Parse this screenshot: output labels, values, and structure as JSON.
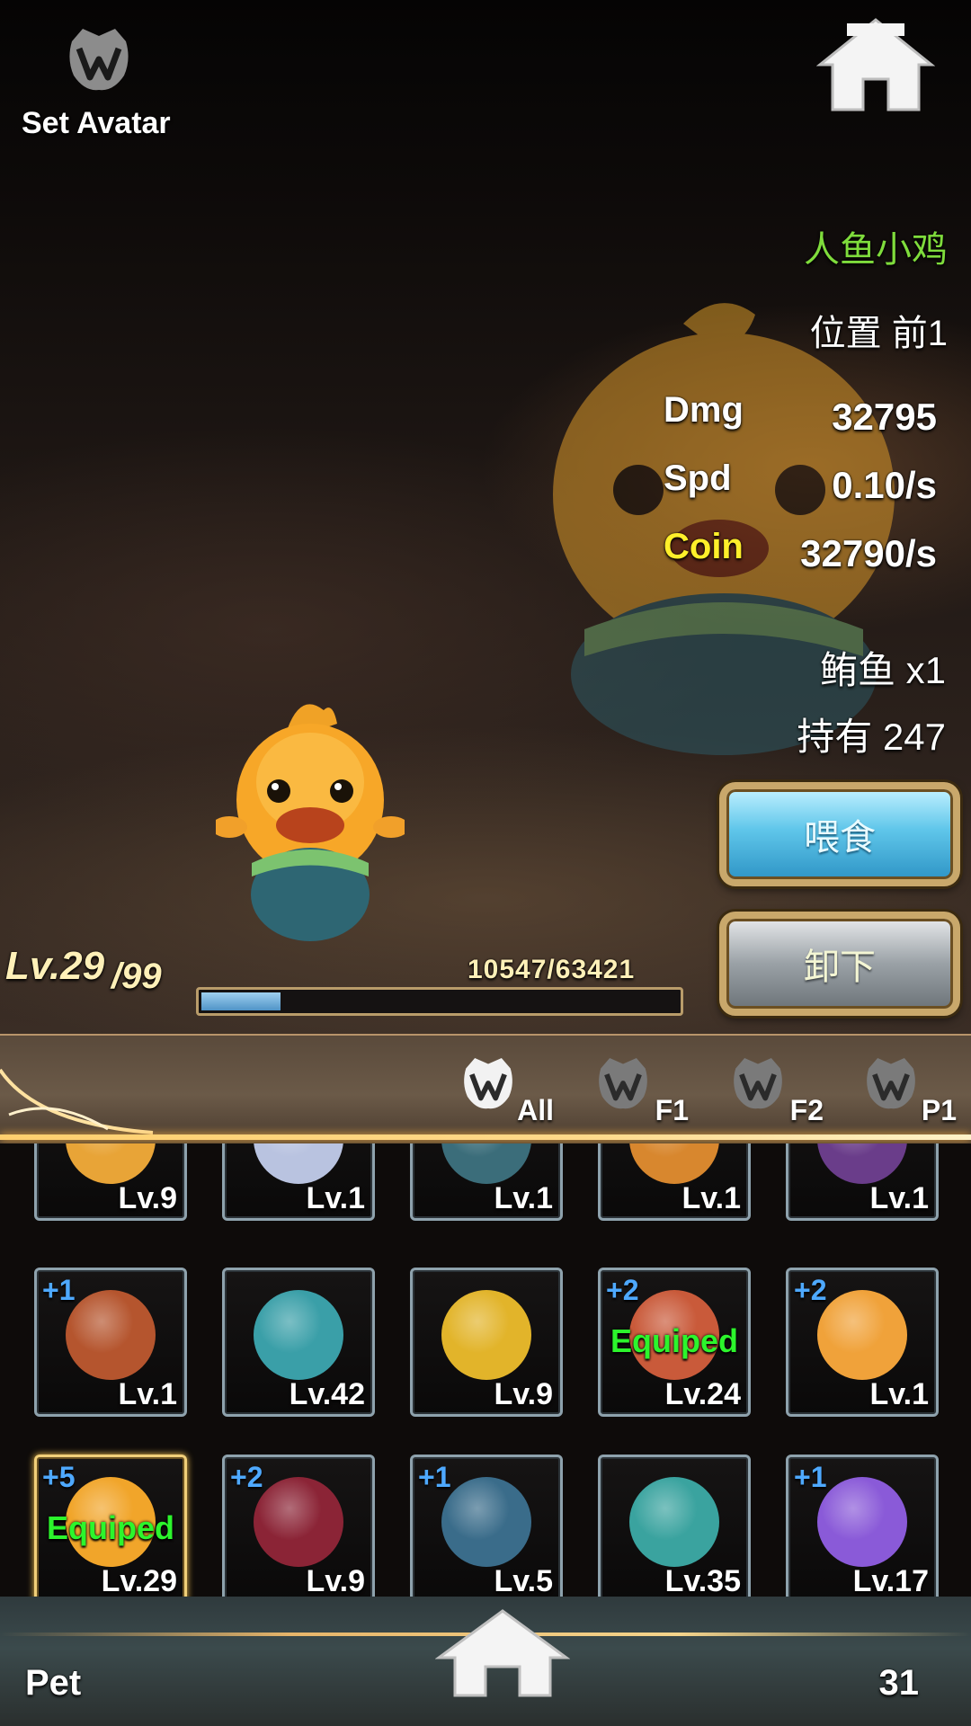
{
  "header": {
    "set_avatar_label": "Set Avatar"
  },
  "pet": {
    "name": "人鱼小鸡",
    "position": "位置 前1",
    "stats": [
      {
        "label": "Dmg",
        "value": "32795"
      },
      {
        "label": "Spd",
        "value": "0.10/s"
      },
      {
        "label": "Coin",
        "value": "32790/s"
      }
    ],
    "food": "鲔鱼 x1",
    "hold": "持有 247",
    "level": "Lv.29",
    "level_max": "/99",
    "exp_text": "10547/63421",
    "exp_fraction": 0.166
  },
  "buttons": {
    "feed": "喂食",
    "unload": "卸下"
  },
  "filters": [
    {
      "label": "All"
    },
    {
      "label": "F1"
    },
    {
      "label": "F2"
    },
    {
      "label": "P1"
    }
  ],
  "grid": [
    {
      "level": "Lv.9",
      "plus": "",
      "equipped": "",
      "color": "#e8a437"
    },
    {
      "level": "Lv.1",
      "plus": "",
      "equipped": "",
      "color": "#b9c3e0"
    },
    {
      "level": "Lv.1",
      "plus": "",
      "equipped": "",
      "color": "#3b6d7a"
    },
    {
      "level": "Lv.1",
      "plus": "",
      "equipped": "",
      "color": "#d8872e"
    },
    {
      "level": "Lv.1",
      "plus": "",
      "equipped": "",
      "color": "#6a3d8a"
    },
    {
      "level": "Lv.1",
      "plus": "+1",
      "equipped": "",
      "color": "#b5552e"
    },
    {
      "level": "Lv.42",
      "plus": "",
      "equipped": "",
      "color": "#3a9fa8"
    },
    {
      "level": "Lv.9",
      "plus": "",
      "equipped": "",
      "color": "#e2b42a"
    },
    {
      "level": "Lv.24",
      "plus": "+2",
      "equipped": "Equiped",
      "color": "#c95a3a"
    },
    {
      "level": "Lv.1",
      "plus": "+2",
      "equipped": "",
      "color": "#f0a23a"
    },
    {
      "level": "Lv.29",
      "plus": "+5",
      "equipped": "Equiped",
      "color": "#f1a52a"
    },
    {
      "level": "Lv.9",
      "plus": "+2",
      "equipped": "",
      "color": "#8b2436"
    },
    {
      "level": "Lv.5",
      "plus": "+1",
      "equipped": "",
      "color": "#3a6c8a"
    },
    {
      "level": "Lv.35",
      "plus": "",
      "equipped": "",
      "color": "#3aa39f"
    },
    {
      "level": "Lv.17",
      "plus": "+1",
      "equipped": "",
      "color": "#8a5ad8"
    }
  ],
  "footer": {
    "label": "Pet",
    "count": "31"
  }
}
